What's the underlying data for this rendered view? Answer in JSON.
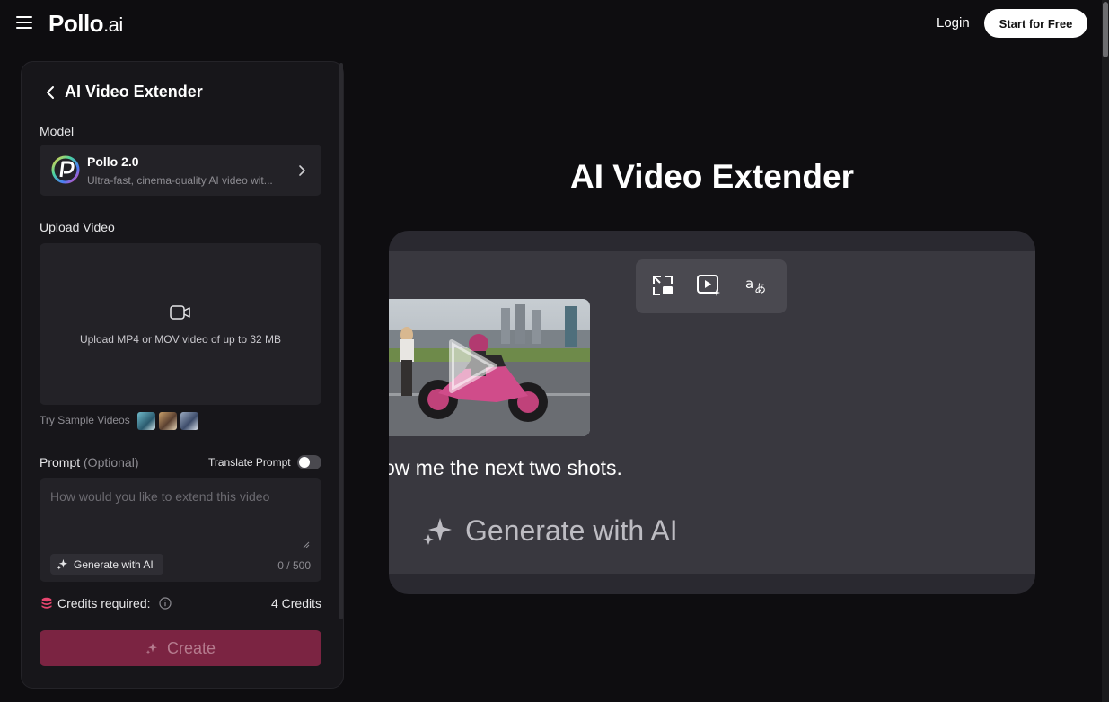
{
  "header": {
    "logo_main": "Pollo",
    "logo_suffix": ".ai",
    "login_label": "Login",
    "start_label": "Start for Free"
  },
  "panel": {
    "title": "AI Video Extender",
    "model_label": "Model",
    "model": {
      "name": "Pollo 2.0",
      "description": "Ultra-fast, cinema-quality AI video wit..."
    },
    "upload_label": "Upload Video",
    "upload_hint": "Upload MP4 or MOV video of up to 32 MB",
    "samples_label": "Try Sample Videos",
    "prompt_label": "Prompt",
    "prompt_optional": "(Optional)",
    "translate_label": "Translate Prompt",
    "translate_enabled": false,
    "prompt_placeholder": "How would you like to extend this video",
    "prompt_value": "",
    "generate_ai_label": "Generate with AI",
    "char_counter": "0 / 500",
    "credits_label": "Credits required:",
    "credits_value": "4 Credits",
    "create_label": "Create"
  },
  "hero": {
    "title": "AI Video Extender",
    "demo_sentence": "ow me the next two shots.",
    "demo_generate_label": "Generate with AI"
  },
  "colors": {
    "background": "#0e0d10",
    "panel": "#17161a",
    "accent": "#7b2442",
    "credits_icon": "#e8456f"
  }
}
